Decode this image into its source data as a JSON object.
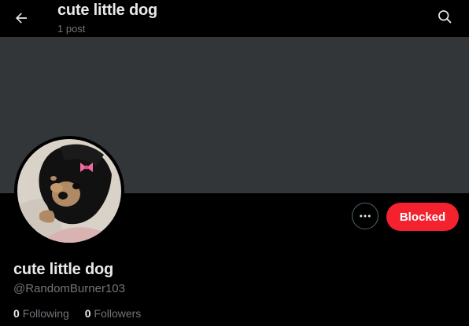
{
  "header": {
    "title": "cute little dog",
    "post_count": "1 post",
    "back_icon": "arrow-left-icon",
    "search_icon": "search-icon"
  },
  "profile": {
    "display_name": "cute little dog",
    "handle": "@RandomBurner103",
    "more_icon": "more-horizontal-icon",
    "blocked_label": "Blocked",
    "following_count": "0",
    "following_label": "Following",
    "followers_count": "0",
    "followers_label": "Followers"
  },
  "colors": {
    "background": "#000000",
    "banner": "#333639",
    "blocked_button": "#f4212e",
    "secondary_text": "#71767b",
    "primary_text": "#e7e9ea"
  }
}
